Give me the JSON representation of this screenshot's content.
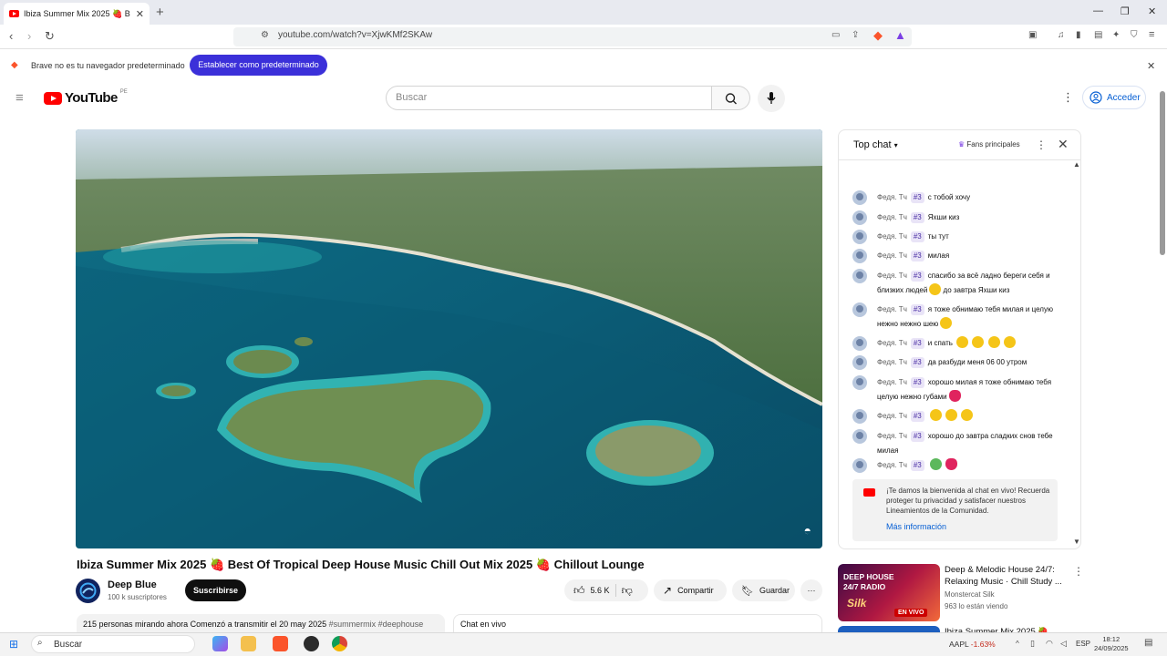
{
  "browser": {
    "tab_title": "Ibiza Summer Mix 2025 🍓 B",
    "url": "youtube.com/watch?v=XjwKMf2SKAw",
    "infobar_text": "Brave no es tu navegador predeterminado",
    "set_default_label": "Establecer como predeterminado"
  },
  "header": {
    "logo_text": "YouTube",
    "country_code": "PE",
    "search_placeholder": "Buscar",
    "signin_label": "Acceder"
  },
  "video": {
    "title": "Ibiza Summer Mix 2025 🍓 Best Of Tropical Deep House Music Chill Out Mix 2025 🍓 Chillout Lounge",
    "channel_name": "Deep Blue",
    "channel_subs": "100 k suscriptores",
    "subscribe_label": "Suscribirse",
    "likes": "5.6 K",
    "share_label": "Compartir",
    "save_label": "Guardar",
    "description_line": "215 personas mirando ahora  Comenzó a transmitir el 20 may 2025",
    "hashtags": "#summermix #deephouse",
    "live_chat_label": "Chat en vivo"
  },
  "chat": {
    "mode_label": "Top chat",
    "fans_label": "Fans principales",
    "messages": [
      {
        "author": "Федя. Тч",
        "badge": "#3",
        "text": "с тобой хочу"
      },
      {
        "author": "Федя. Тч",
        "badge": "#3",
        "text": "Яхши киз"
      },
      {
        "author": "Федя. Тч",
        "badge": "#3",
        "text": "ты тут"
      },
      {
        "author": "Федя. Тч",
        "badge": "#3",
        "text": "милая"
      },
      {
        "author": "Федя. Тч",
        "badge": "#3",
        "text": "спасибо за всё ладно береги себя и близких людей",
        "text2": "до завтра Яхши киз"
      },
      {
        "author": "Федя. Тч",
        "badge": "#3",
        "text": "я тоже обнимаю тебя милая и целую нежно нежно шею"
      },
      {
        "author": "Федя. Тч",
        "badge": "#3",
        "text": "и спать"
      },
      {
        "author": "Федя. Тч",
        "badge": "#3",
        "text": "да разбуди меня 06 00 утром"
      },
      {
        "author": "Федя. Тч",
        "badge": "#3",
        "text": "хорошо милая я тоже обнимаю тебя целую нежно губами"
      },
      {
        "author": "Федя. Тч",
        "badge": "#3",
        "text": ""
      },
      {
        "author": "Федя. Тч",
        "badge": "#3",
        "text": "хорошо до завтра сладких снов тебе милая"
      },
      {
        "author": "Федя. Тч",
        "badge": "#3",
        "text": ""
      }
    ],
    "notice_text": "¡Te damos la bienvenida al chat en vivo! Recuerda proteger tu privacidad y satisfacer nuestros Lineamientos de la Comunidad.",
    "notice_link": "Más información"
  },
  "recommendations": [
    {
      "title": "Deep & Melodic House 24/7: Relaxing Music · Chill Study ...",
      "channel": "Monstercat Silk",
      "views": "963 lo están viendo",
      "thumb_line1": "DEEP HOUSE",
      "thumb_line2": "24/7 RADIO",
      "thumb_brand": "Silk",
      "live_badge": "EN VIVO"
    },
    {
      "title": "Ibiza Summer Mix 2025 🍓"
    }
  ],
  "taskbar": {
    "search_label": "Buscar",
    "ticker_symbol": "AAPL",
    "ticker_change": "-1.63%",
    "language": "ESP",
    "time": "18:12",
    "date": "24/09/2025"
  },
  "colors": {
    "youtube_red": "#ff0000",
    "brave_button": "#3b30d9",
    "link_blue": "#065fd4"
  }
}
